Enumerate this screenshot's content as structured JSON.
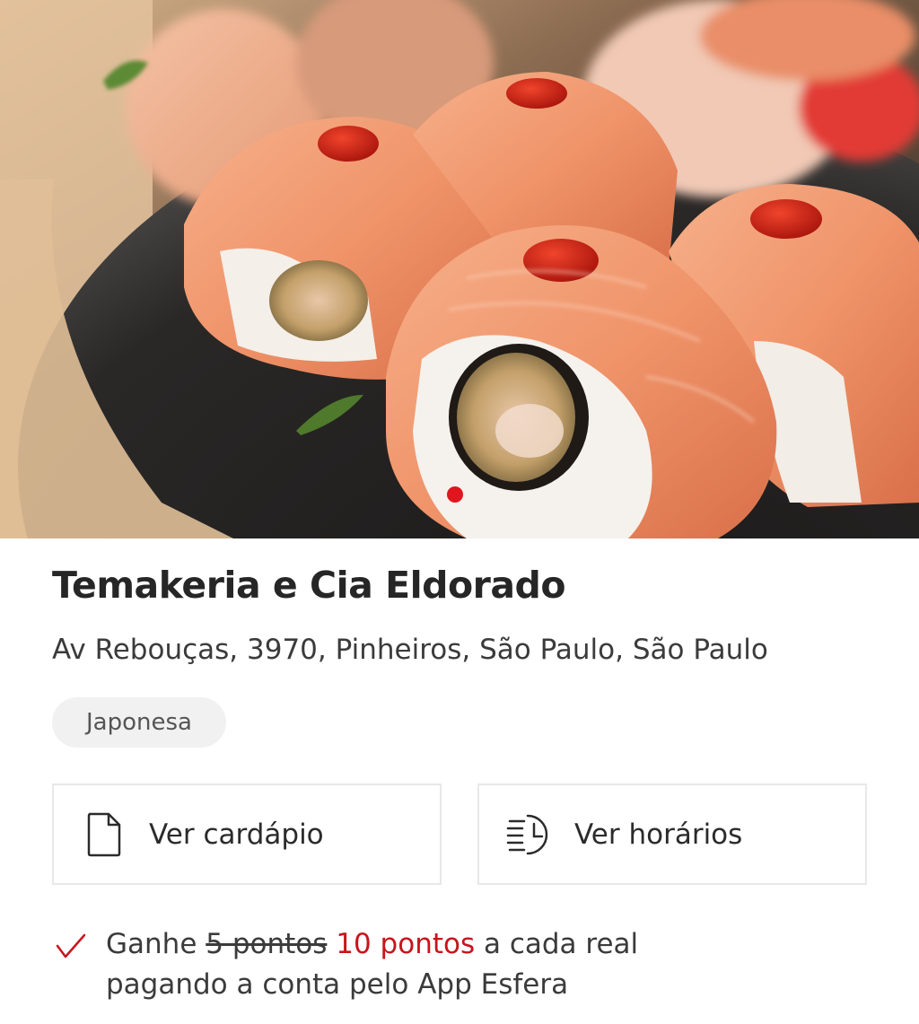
{
  "restaurant": {
    "name": "Temakeria e Cia Eldorado",
    "address": "Av Rebouças, 3970, Pinheiros, São Paulo, São Paulo",
    "cuisine_tag": "Japonesa"
  },
  "carousel": {
    "active_index": 1,
    "dot_color": "#e0161f"
  },
  "actions": {
    "menu_label": "Ver cardápio",
    "menu_icon": "document-icon",
    "hours_label": "Ver horários",
    "hours_icon": "clock-list-icon"
  },
  "promo": {
    "icon": "check-icon",
    "prefix": "Ganhe",
    "old_points": "5 pontos",
    "new_points": "10 pontos",
    "suffix": "a cada real",
    "line2": "pagando a conta pelo App Esfera",
    "accent_color": "#c8141c"
  }
}
